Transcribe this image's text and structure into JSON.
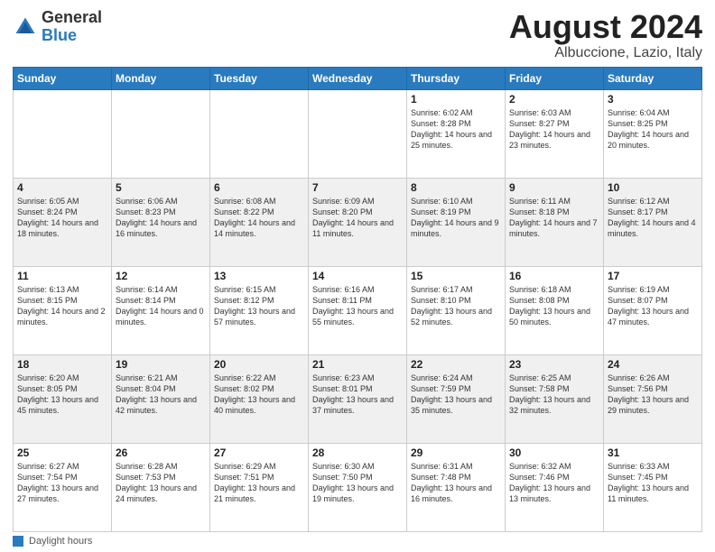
{
  "header": {
    "logo_general": "General",
    "logo_blue": "Blue",
    "title": "August 2024",
    "subtitle": "Albuccione, Lazio, Italy"
  },
  "days_of_week": [
    "Sunday",
    "Monday",
    "Tuesday",
    "Wednesday",
    "Thursday",
    "Friday",
    "Saturday"
  ],
  "weeks": [
    [
      {
        "day": "",
        "info": ""
      },
      {
        "day": "",
        "info": ""
      },
      {
        "day": "",
        "info": ""
      },
      {
        "day": "",
        "info": ""
      },
      {
        "day": "1",
        "info": "Sunrise: 6:02 AM\nSunset: 8:28 PM\nDaylight: 14 hours and 25 minutes."
      },
      {
        "day": "2",
        "info": "Sunrise: 6:03 AM\nSunset: 8:27 PM\nDaylight: 14 hours and 23 minutes."
      },
      {
        "day": "3",
        "info": "Sunrise: 6:04 AM\nSunset: 8:25 PM\nDaylight: 14 hours and 20 minutes."
      }
    ],
    [
      {
        "day": "4",
        "info": "Sunrise: 6:05 AM\nSunset: 8:24 PM\nDaylight: 14 hours and 18 minutes."
      },
      {
        "day": "5",
        "info": "Sunrise: 6:06 AM\nSunset: 8:23 PM\nDaylight: 14 hours and 16 minutes."
      },
      {
        "day": "6",
        "info": "Sunrise: 6:08 AM\nSunset: 8:22 PM\nDaylight: 14 hours and 14 minutes."
      },
      {
        "day": "7",
        "info": "Sunrise: 6:09 AM\nSunset: 8:20 PM\nDaylight: 14 hours and 11 minutes."
      },
      {
        "day": "8",
        "info": "Sunrise: 6:10 AM\nSunset: 8:19 PM\nDaylight: 14 hours and 9 minutes."
      },
      {
        "day": "9",
        "info": "Sunrise: 6:11 AM\nSunset: 8:18 PM\nDaylight: 14 hours and 7 minutes."
      },
      {
        "day": "10",
        "info": "Sunrise: 6:12 AM\nSunset: 8:17 PM\nDaylight: 14 hours and 4 minutes."
      }
    ],
    [
      {
        "day": "11",
        "info": "Sunrise: 6:13 AM\nSunset: 8:15 PM\nDaylight: 14 hours and 2 minutes."
      },
      {
        "day": "12",
        "info": "Sunrise: 6:14 AM\nSunset: 8:14 PM\nDaylight: 14 hours and 0 minutes."
      },
      {
        "day": "13",
        "info": "Sunrise: 6:15 AM\nSunset: 8:12 PM\nDaylight: 13 hours and 57 minutes."
      },
      {
        "day": "14",
        "info": "Sunrise: 6:16 AM\nSunset: 8:11 PM\nDaylight: 13 hours and 55 minutes."
      },
      {
        "day": "15",
        "info": "Sunrise: 6:17 AM\nSunset: 8:10 PM\nDaylight: 13 hours and 52 minutes."
      },
      {
        "day": "16",
        "info": "Sunrise: 6:18 AM\nSunset: 8:08 PM\nDaylight: 13 hours and 50 minutes."
      },
      {
        "day": "17",
        "info": "Sunrise: 6:19 AM\nSunset: 8:07 PM\nDaylight: 13 hours and 47 minutes."
      }
    ],
    [
      {
        "day": "18",
        "info": "Sunrise: 6:20 AM\nSunset: 8:05 PM\nDaylight: 13 hours and 45 minutes."
      },
      {
        "day": "19",
        "info": "Sunrise: 6:21 AM\nSunset: 8:04 PM\nDaylight: 13 hours and 42 minutes."
      },
      {
        "day": "20",
        "info": "Sunrise: 6:22 AM\nSunset: 8:02 PM\nDaylight: 13 hours and 40 minutes."
      },
      {
        "day": "21",
        "info": "Sunrise: 6:23 AM\nSunset: 8:01 PM\nDaylight: 13 hours and 37 minutes."
      },
      {
        "day": "22",
        "info": "Sunrise: 6:24 AM\nSunset: 7:59 PM\nDaylight: 13 hours and 35 minutes."
      },
      {
        "day": "23",
        "info": "Sunrise: 6:25 AM\nSunset: 7:58 PM\nDaylight: 13 hours and 32 minutes."
      },
      {
        "day": "24",
        "info": "Sunrise: 6:26 AM\nSunset: 7:56 PM\nDaylight: 13 hours and 29 minutes."
      }
    ],
    [
      {
        "day": "25",
        "info": "Sunrise: 6:27 AM\nSunset: 7:54 PM\nDaylight: 13 hours and 27 minutes."
      },
      {
        "day": "26",
        "info": "Sunrise: 6:28 AM\nSunset: 7:53 PM\nDaylight: 13 hours and 24 minutes."
      },
      {
        "day": "27",
        "info": "Sunrise: 6:29 AM\nSunset: 7:51 PM\nDaylight: 13 hours and 21 minutes."
      },
      {
        "day": "28",
        "info": "Sunrise: 6:30 AM\nSunset: 7:50 PM\nDaylight: 13 hours and 19 minutes."
      },
      {
        "day": "29",
        "info": "Sunrise: 6:31 AM\nSunset: 7:48 PM\nDaylight: 13 hours and 16 minutes."
      },
      {
        "day": "30",
        "info": "Sunrise: 6:32 AM\nSunset: 7:46 PM\nDaylight: 13 hours and 13 minutes."
      },
      {
        "day": "31",
        "info": "Sunrise: 6:33 AM\nSunset: 7:45 PM\nDaylight: 13 hours and 11 minutes."
      }
    ]
  ],
  "footer": {
    "label": "Daylight hours"
  }
}
